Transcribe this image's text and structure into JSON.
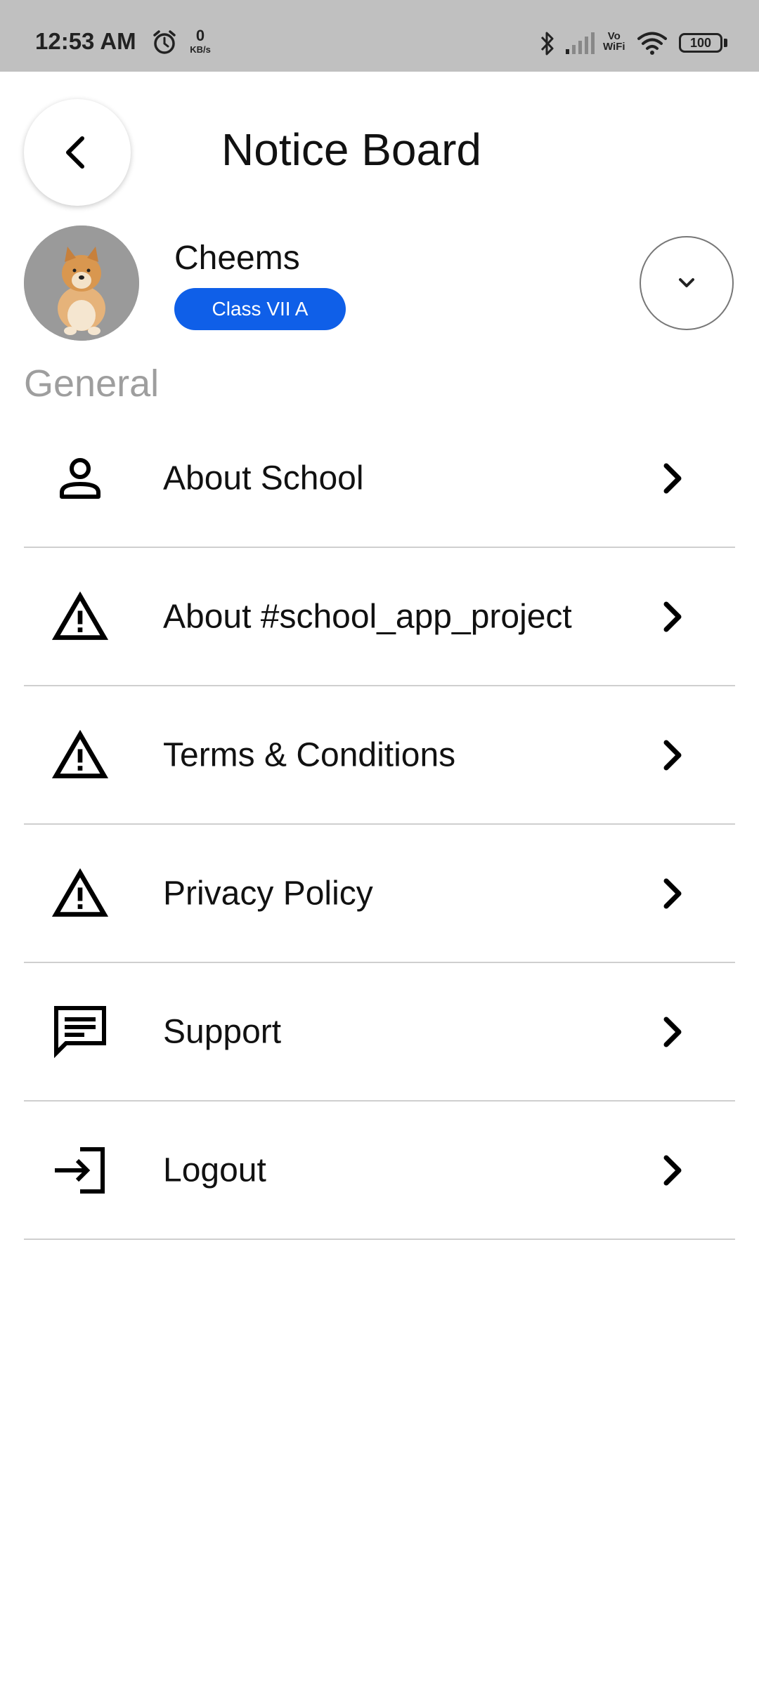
{
  "status_bar": {
    "time": "12:53 AM",
    "net_speed_value": "0",
    "net_speed_unit": "KB/s",
    "vowifi_top": "Vo",
    "vowifi_bottom": "WiFi",
    "battery": "100",
    "icons": [
      "alarm-icon",
      "bluetooth-icon",
      "signal-icon",
      "wifi-icon",
      "battery-icon"
    ]
  },
  "header": {
    "title": "Notice Board",
    "back_icon": "chevron-left-icon"
  },
  "profile": {
    "name": "Cheems",
    "class_badge": "Class VII A",
    "badge_color": "#0f5fe8",
    "dropdown_icon": "chevron-down-icon"
  },
  "section": {
    "label": "General"
  },
  "menu": {
    "items": [
      {
        "label": "About School",
        "icon": "person-icon"
      },
      {
        "label": "About #school_app_project",
        "icon": "warning-icon"
      },
      {
        "label": "Terms & Conditions",
        "icon": "warning-icon"
      },
      {
        "label": "Privacy Policy",
        "icon": "warning-icon"
      },
      {
        "label": "Support",
        "icon": "message-icon"
      },
      {
        "label": "Logout",
        "icon": "login-icon"
      }
    ]
  }
}
